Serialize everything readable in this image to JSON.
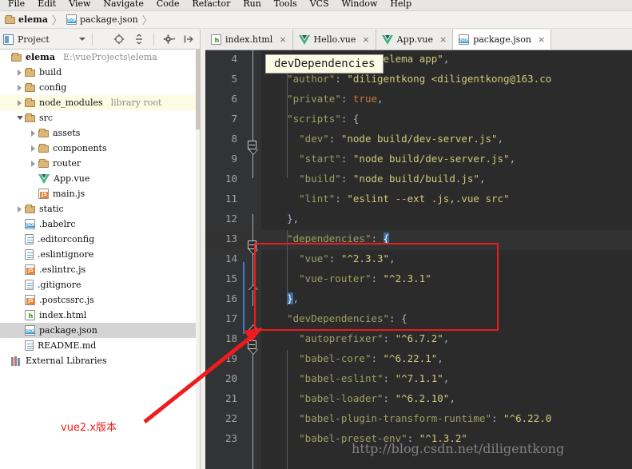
{
  "menu": {
    "items": [
      "File",
      "Edit",
      "View",
      "Navigate",
      "Code",
      "Refactor",
      "Run",
      "Tools",
      "VCS",
      "Window",
      "Help"
    ]
  },
  "breadcrumb": {
    "project": "elema",
    "file": "package.json",
    "separator": "〉"
  },
  "toolbar": {
    "project_label": "Project",
    "icons": [
      "locate-icon",
      "collapse-all-icon",
      "settings-icon",
      "hide-panel-icon"
    ]
  },
  "tree": {
    "root": {
      "label": "elema",
      "path": "E:\\vueProjects\\elema",
      "icon": "folder-icon"
    },
    "items": [
      {
        "label": "build",
        "icon": "folder-icon",
        "indent": 1,
        "arrow": "right",
        "state": "normal"
      },
      {
        "label": "config",
        "icon": "folder-icon",
        "indent": 1,
        "arrow": "right",
        "state": "normal"
      },
      {
        "label": "node_modules",
        "icon": "folder-icon",
        "indent": 1,
        "arrow": "right",
        "state": "highlight",
        "note": "library root"
      },
      {
        "label": "src",
        "icon": "folder-icon",
        "indent": 1,
        "arrow": "down",
        "state": "normal"
      },
      {
        "label": "assets",
        "icon": "folder-icon",
        "indent": 2,
        "arrow": "right",
        "state": "normal"
      },
      {
        "label": "components",
        "icon": "folder-icon",
        "indent": 2,
        "arrow": "right",
        "state": "normal"
      },
      {
        "label": "router",
        "icon": "folder-icon",
        "indent": 2,
        "arrow": "right",
        "state": "normal"
      },
      {
        "label": "App.vue",
        "icon": "vue-icon",
        "indent": 2,
        "arrow": "none",
        "state": "normal"
      },
      {
        "label": "main.js",
        "icon": "js-icon",
        "indent": 2,
        "arrow": "none",
        "state": "normal"
      },
      {
        "label": "static",
        "icon": "folder-icon",
        "indent": 1,
        "arrow": "right",
        "state": "normal"
      },
      {
        "label": ".babelrc",
        "icon": "json-icon",
        "indent": 1,
        "arrow": "none",
        "state": "normal"
      },
      {
        "label": ".editorconfig",
        "icon": "doc-icon",
        "indent": 1,
        "arrow": "none",
        "state": "normal"
      },
      {
        "label": ".eslintignore",
        "icon": "doc-icon",
        "indent": 1,
        "arrow": "none",
        "state": "normal"
      },
      {
        "label": ".eslintrc.js",
        "icon": "js-icon",
        "indent": 1,
        "arrow": "none",
        "state": "normal"
      },
      {
        "label": ".gitignore",
        "icon": "doc-icon",
        "indent": 1,
        "arrow": "none",
        "state": "normal"
      },
      {
        "label": ".postcssrc.js",
        "icon": "js-icon",
        "indent": 1,
        "arrow": "none",
        "state": "normal"
      },
      {
        "label": "index.html",
        "icon": "html-icon",
        "indent": 1,
        "arrow": "none",
        "state": "normal"
      },
      {
        "label": "package.json",
        "icon": "json-icon",
        "indent": 1,
        "arrow": "none",
        "state": "selected"
      },
      {
        "label": "README.md",
        "icon": "doc-icon",
        "indent": 1,
        "arrow": "none",
        "state": "normal"
      },
      {
        "label": "External Libraries",
        "icon": "libraries-icon",
        "indent": 0,
        "arrow": "none",
        "state": "normal"
      }
    ]
  },
  "tabs": [
    {
      "label": "index.html",
      "icon": "html-icon",
      "active": false,
      "close": "×"
    },
    {
      "label": "Hello.vue",
      "icon": "vue-icon",
      "active": false,
      "close": "×"
    },
    {
      "label": "App.vue",
      "icon": "vue-icon",
      "active": false,
      "close": "×"
    },
    {
      "label": "package.json",
      "icon": "json-icon",
      "active": true,
      "close": "×"
    }
  ],
  "tooltip": {
    "text": "devDependencies"
  },
  "editor": {
    "first_line": 4,
    "lines": [
      {
        "n": 4,
        "text": "    \"description\": \"elema app\","
      },
      {
        "n": 5,
        "text": "    \"author\": \"diligentkong <diligentkong@163.co"
      },
      {
        "n": 6,
        "text": "    \"private\": true,"
      },
      {
        "n": 7,
        "text": "    \"scripts\": {"
      },
      {
        "n": 8,
        "text": "      \"dev\": \"node build/dev-server.js\","
      },
      {
        "n": 9,
        "text": "      \"start\": \"node build/dev-server.js\","
      },
      {
        "n": 10,
        "text": "      \"build\": \"node build/build.js\","
      },
      {
        "n": 11,
        "text": "      \"lint\": \"eslint --ext .js,.vue src\""
      },
      {
        "n": 12,
        "text": "    },"
      },
      {
        "n": 13,
        "text": "    \"dependencies\": {"
      },
      {
        "n": 14,
        "text": "      \"vue\": \"^2.3.3\","
      },
      {
        "n": 15,
        "text": "      \"vue-router\": \"^2.3.1\""
      },
      {
        "n": 16,
        "text": "    },"
      },
      {
        "n": 17,
        "text": "    \"devDependencies\": {"
      },
      {
        "n": 18,
        "text": "      \"autoprefixer\": \"^6.7.2\","
      },
      {
        "n": 19,
        "text": "      \"babel-core\": \"^6.22.1\","
      },
      {
        "n": 20,
        "text": "      \"babel-eslint\": \"^7.1.1\","
      },
      {
        "n": 21,
        "text": "      \"babel-loader\": \"^6.2.10\","
      },
      {
        "n": 22,
        "text": "      \"babel-plugin-transform-runtime\": \"^6.22.0"
      },
      {
        "n": 23,
        "text": "      \"babel-preset-env\": \"^1.3.2\""
      }
    ]
  },
  "annotation": {
    "note": "vue2.x版本",
    "color": "#ee1c1c"
  },
  "watermark": {
    "text": "http://blog.csdn.net/diligentkong"
  },
  "colors": {
    "editor_bg": "#2b2b2b",
    "gutter_bg": "#313335",
    "key": "#9e9e64",
    "string": "#a5c261",
    "value": "#d0c87a",
    "keyword": "#cc7832",
    "selection": "#3b7fd4",
    "annotation_red": "#ee1c1c",
    "tree_selected": "#d4d4d4",
    "tree_highlight": "#fcfbe3"
  }
}
